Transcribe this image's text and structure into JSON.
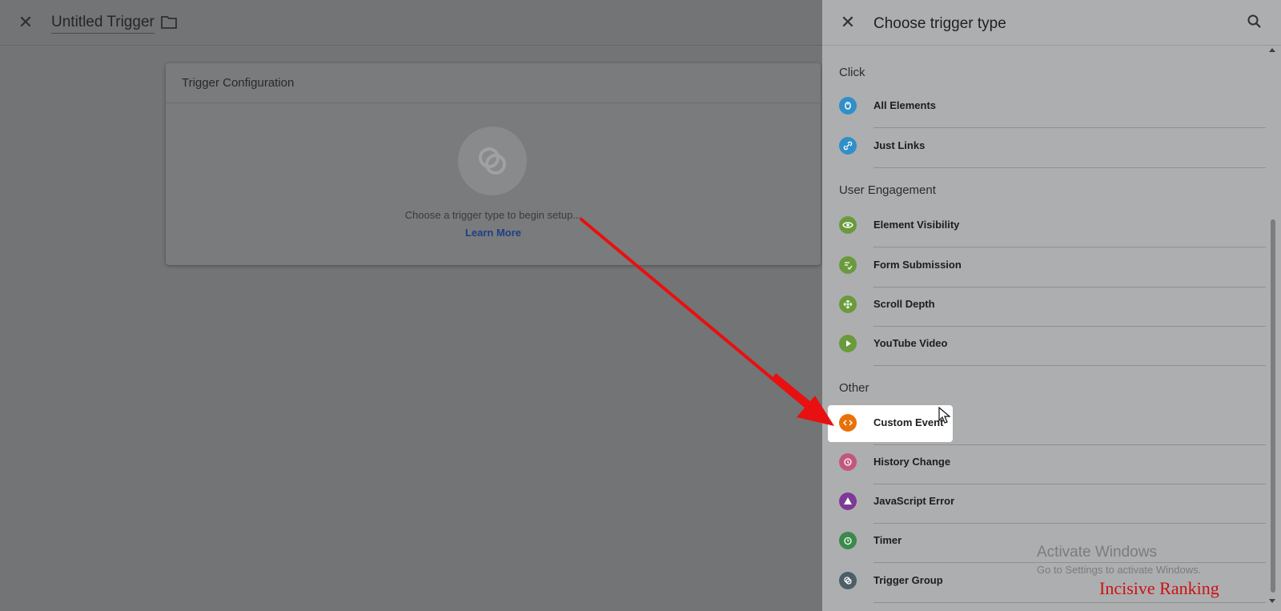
{
  "editor": {
    "title": "Untitled Trigger",
    "config_title": "Trigger Configuration",
    "config_message": "Choose a trigger type to begin setup...",
    "config_link": "Learn More"
  },
  "panel": {
    "title": "Choose trigger type",
    "sections": [
      {
        "title": "Click"
      },
      {
        "title": "User Engagement"
      },
      {
        "title": "Other"
      }
    ],
    "items": [
      {
        "label": "All Elements",
        "icon": "cursor-icon",
        "color": "#2f8fc9"
      },
      {
        "label": "Just Links",
        "icon": "link-icon",
        "color": "#2f8fc9"
      },
      {
        "label": "Element Visibility",
        "icon": "eye-icon",
        "color": "#6a9a3b"
      },
      {
        "label": "Form Submission",
        "icon": "form-icon",
        "color": "#6a9a3b"
      },
      {
        "label": "Scroll Depth",
        "icon": "move-icon",
        "color": "#6a9a3b"
      },
      {
        "label": "YouTube Video",
        "icon": "play-icon",
        "color": "#6a9a3b"
      },
      {
        "label": "Custom Event",
        "icon": "code-icon",
        "color": "#e8710a"
      },
      {
        "label": "History Change",
        "icon": "history-icon",
        "color": "#c2567e"
      },
      {
        "label": "JavaScript Error",
        "icon": "warning-icon",
        "color": "#7e3a94"
      },
      {
        "label": "Timer",
        "icon": "timer-icon",
        "color": "#3b8a4a"
      },
      {
        "label": "Trigger Group",
        "icon": "group-icon",
        "color": "#4d5e69"
      }
    ]
  },
  "overlay": {
    "activate_title": "Activate Windows",
    "activate_sub": "Go to Settings to activate Windows.",
    "watermark": "Incisive Ranking"
  }
}
